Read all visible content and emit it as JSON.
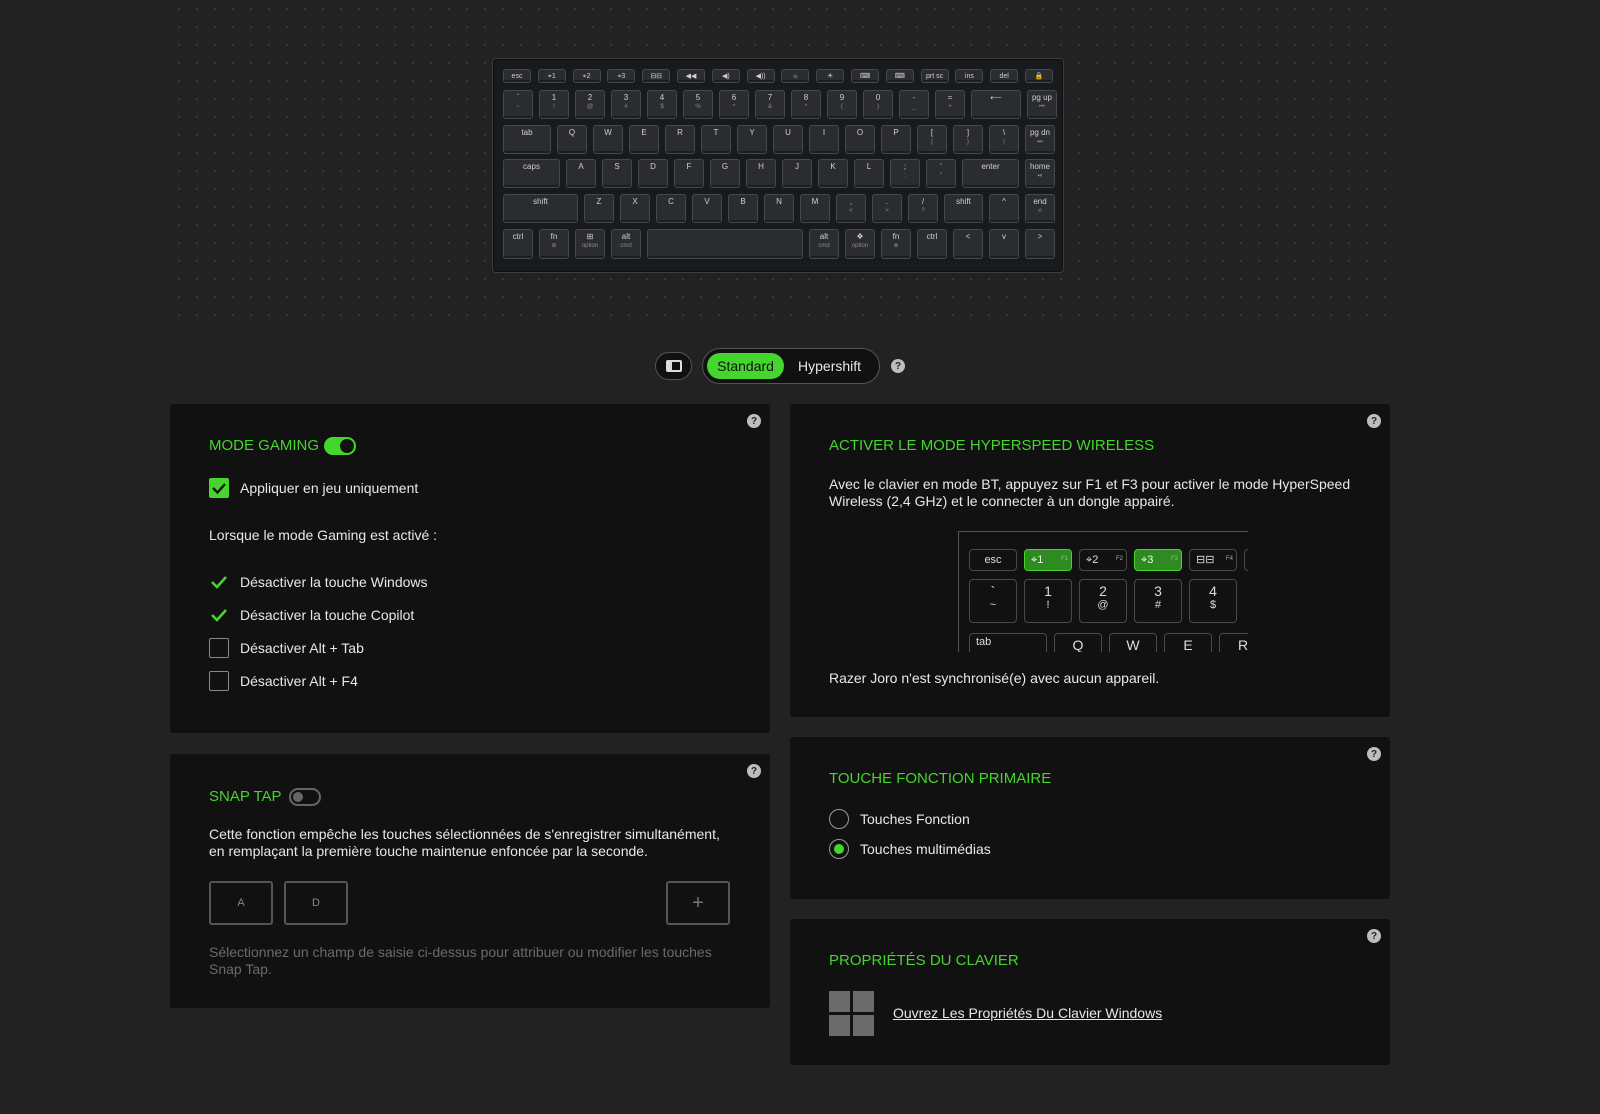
{
  "keyboard": {
    "row_fn": [
      {
        "top": "esc",
        "bottom": ""
      },
      {
        "top": "⌖1",
        "bottom": "F1"
      },
      {
        "top": "⌖2",
        "bottom": "F2"
      },
      {
        "top": "⌖3",
        "bottom": "F3"
      },
      {
        "top": "⊟⊟",
        "bottom": "F4"
      },
      {
        "top": "◀◀",
        "bottom": "F5"
      },
      {
        "top": "◀)",
        "bottom": "F6"
      },
      {
        "top": "◀))",
        "bottom": "F7"
      },
      {
        "top": "☼",
        "bottom": "F8"
      },
      {
        "top": "☀",
        "bottom": "F9"
      },
      {
        "top": "⌨",
        "bottom": "F10"
      },
      {
        "top": "⌨",
        "bottom": "F11"
      },
      {
        "top": "prt sc",
        "bottom": "F12"
      },
      {
        "top": "ins",
        "bottom": ""
      },
      {
        "top": "del",
        "bottom": ""
      },
      {
        "top": "🔒",
        "bottom": ""
      }
    ],
    "row_num": [
      {
        "top": "`",
        "bottom": "~"
      },
      {
        "top": "1",
        "bottom": "!"
      },
      {
        "top": "2",
        "bottom": "@"
      },
      {
        "top": "3",
        "bottom": "#"
      },
      {
        "top": "4",
        "bottom": "$"
      },
      {
        "top": "5",
        "bottom": "%"
      },
      {
        "top": "6",
        "bottom": "^"
      },
      {
        "top": "7",
        "bottom": "&"
      },
      {
        "top": "8",
        "bottom": "*"
      },
      {
        "top": "9",
        "bottom": "("
      },
      {
        "top": "0",
        "bottom": ")"
      },
      {
        "top": "-",
        "bottom": "_"
      },
      {
        "top": "=",
        "bottom": "+"
      },
      {
        "top": "⟵",
        "bottom": ""
      },
      {
        "top": "pg up",
        "bottom": "⏮"
      }
    ],
    "row_q": [
      {
        "top": "tab",
        "bottom": ""
      },
      {
        "top": "Q",
        "bottom": ""
      },
      {
        "top": "W",
        "bottom": ""
      },
      {
        "top": "E",
        "bottom": ""
      },
      {
        "top": "R",
        "bottom": ""
      },
      {
        "top": "T",
        "bottom": ""
      },
      {
        "top": "Y",
        "bottom": ""
      },
      {
        "top": "U",
        "bottom": ""
      },
      {
        "top": "I",
        "bottom": ""
      },
      {
        "top": "O",
        "bottom": ""
      },
      {
        "top": "P",
        "bottom": ""
      },
      {
        "top": "[",
        "bottom": "{"
      },
      {
        "top": "]",
        "bottom": "}"
      },
      {
        "top": "\\",
        "bottom": "|"
      },
      {
        "top": "pg dn",
        "bottom": "⏭"
      }
    ],
    "row_a": [
      {
        "top": "caps",
        "bottom": ""
      },
      {
        "top": "A",
        "bottom": ""
      },
      {
        "top": "S",
        "bottom": ""
      },
      {
        "top": "D",
        "bottom": ""
      },
      {
        "top": "F",
        "bottom": ""
      },
      {
        "top": "G",
        "bottom": ""
      },
      {
        "top": "H",
        "bottom": ""
      },
      {
        "top": "J",
        "bottom": ""
      },
      {
        "top": "K",
        "bottom": ""
      },
      {
        "top": "L",
        "bottom": ""
      },
      {
        "top": ";",
        "bottom": ":"
      },
      {
        "top": "'",
        "bottom": "\""
      },
      {
        "top": "enter",
        "bottom": ""
      },
      {
        "top": "home",
        "bottom": "⏯"
      }
    ],
    "row_z": [
      {
        "top": "shift",
        "bottom": ""
      },
      {
        "top": "Z",
        "bottom": ""
      },
      {
        "top": "X",
        "bottom": ""
      },
      {
        "top": "C",
        "bottom": ""
      },
      {
        "top": "V",
        "bottom": ""
      },
      {
        "top": "B",
        "bottom": ""
      },
      {
        "top": "N",
        "bottom": ""
      },
      {
        "top": "M",
        "bottom": ""
      },
      {
        "top": ",",
        "bottom": "<"
      },
      {
        "top": ".",
        "bottom": ">"
      },
      {
        "top": "/",
        "bottom": "?"
      },
      {
        "top": "shift",
        "bottom": ""
      },
      {
        "top": "^",
        "bottom": ""
      },
      {
        "top": "end",
        "bottom": "≤"
      }
    ],
    "row_bottom": [
      {
        "top": "ctrl",
        "bottom": ""
      },
      {
        "top": "fn",
        "bottom": "⊕"
      },
      {
        "top": "⊞",
        "bottom": "option"
      },
      {
        "top": "alt",
        "bottom": "cmd"
      },
      {
        "top": "",
        "bottom": ""
      },
      {
        "top": "alt",
        "bottom": "cmd"
      },
      {
        "top": "❖",
        "bottom": "option"
      },
      {
        "top": "fn",
        "bottom": "⊕"
      },
      {
        "top": "ctrl",
        "bottom": ""
      },
      {
        "top": "<",
        "bottom": ""
      },
      {
        "top": "v",
        "bottom": ""
      },
      {
        "top": ">",
        "bottom": ""
      }
    ]
  },
  "toolbar": {
    "layout_icon": "sidebar-layout-icon",
    "standard": "Standard",
    "hypershift": "Hypershift",
    "help": "?"
  },
  "gaming": {
    "title": "MODE GAMING",
    "apply_label": "Appliquer en jeu uniquement",
    "intro": "Lorsque le mode Gaming est activé :",
    "options": [
      {
        "label": "Désactiver la touche Windows",
        "checked": true
      },
      {
        "label": "Désactiver la touche Copilot",
        "checked": true
      },
      {
        "label": "Désactiver Alt + Tab",
        "checked": false
      },
      {
        "label": "Désactiver Alt + F4",
        "checked": false
      }
    ],
    "help": "?"
  },
  "snaptap": {
    "title": "SNAP TAP",
    "desc": "Cette fonction empêche les touches sélectionnées de s'enregistrer simultanément, en remplaçant la première touche maintenue enfoncée par la seconde.",
    "key1": "A",
    "key2": "D",
    "add": "+",
    "hint": "Sélectionnez un champ de saisie ci-dessus pour attribuer ou modifier les touches Snap Tap.",
    "help": "?"
  },
  "hyperspeed": {
    "title": "ACTIVER LE MODE HYPERSPEED WIRELESS",
    "desc": "Avec le clavier en mode BT, appuyez sur F1 et F3 pour activer le mode HyperSpeed Wireless (2,4 GHz) et le connecter à un dongle appairé.",
    "status": "Razer Joro n'est synchronisé(e) avec aucun appareil.",
    "help": "?",
    "mini_fn": [
      {
        "top": "esc",
        "sub": ""
      },
      {
        "top": "⌖1",
        "sub": "F1"
      },
      {
        "top": "⌖2",
        "sub": "F2"
      },
      {
        "top": "⌖3",
        "sub": "F3"
      },
      {
        "top": "⊟⊟",
        "sub": "F4"
      }
    ],
    "mini_num": [
      {
        "top": "`",
        "bottom": "~"
      },
      {
        "top": "1",
        "bottom": "!"
      },
      {
        "top": "2",
        "bottom": "@"
      },
      {
        "top": "3",
        "bottom": "#"
      },
      {
        "top": "4",
        "bottom": "$"
      }
    ],
    "mini_q": [
      "tab",
      "Q",
      "W",
      "E",
      "R"
    ]
  },
  "primary": {
    "title": "TOUCHE FONCTION PRIMAIRE",
    "opt1": "Touches Fonction",
    "opt2": "Touches multimédias",
    "selected": "Touches multimédias",
    "help": "?"
  },
  "props": {
    "title": "PROPRIÉTÉS DU CLAVIER",
    "link": "Ouvrez Les Propriétés Du Clavier Windows",
    "help": "?"
  },
  "colors": {
    "accent": "#44d62c",
    "panel": "#111111",
    "bg": "#222222"
  }
}
